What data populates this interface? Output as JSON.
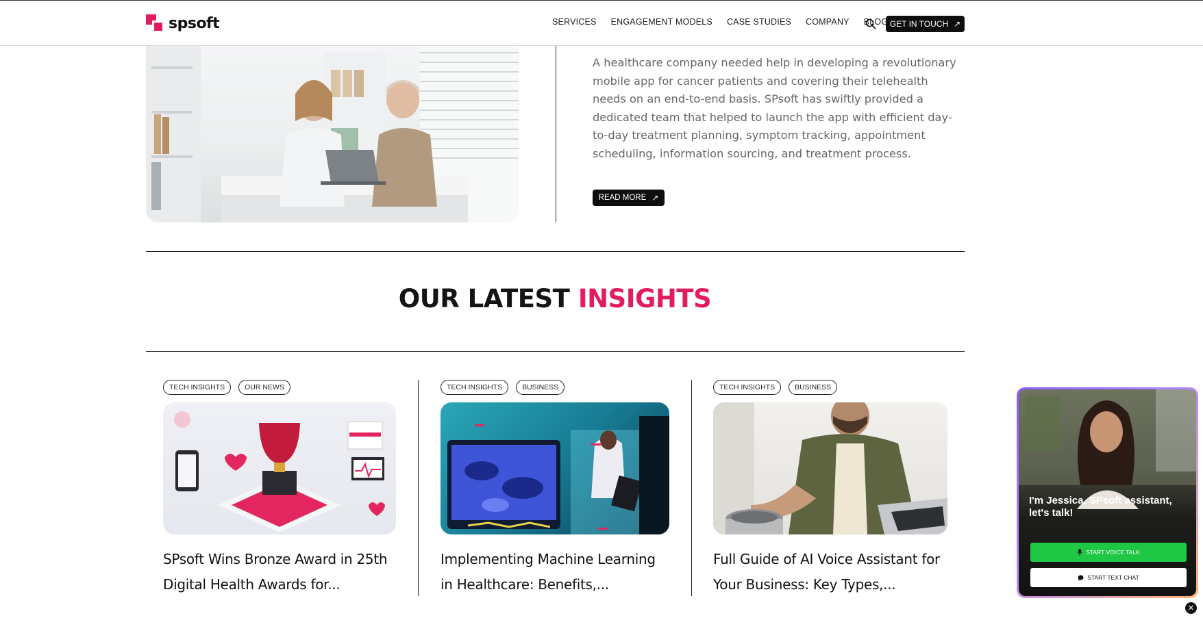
{
  "header": {
    "logo_text": "spsoft",
    "nav": [
      "SERVICES",
      "ENGAGEMENT MODELS",
      "CASE STUDIES",
      "COMPANY",
      "BLOG"
    ],
    "cta_label": "GET IN TOUCH",
    "icons": {
      "search": "search-icon",
      "cta_arrow": "arrow-up-right-icon"
    }
  },
  "case_study": {
    "description": "A healthcare company needed help in developing a revolutionary mobile app for cancer patients and covering their telehealth needs on an end-to-end basis. SPsoft has swiftly provided a dedicated team that helped to launch the app with efficient day-to-day treatment planning, symptom tracking, appointment scheduling, information sourcing, and treatment process.",
    "read_more_label": "READ MORE"
  },
  "insights": {
    "title_part1": "OUR LATEST",
    "title_part2": "INSIGHTS",
    "cards": [
      {
        "tags": [
          "TECH INSIGHTS",
          "OUR NEWS"
        ],
        "title": "SPsoft Wins Bronze Award in 25th Digital Health Awards for..."
      },
      {
        "tags": [
          "TECH INSIGHTS",
          "BUSINESS"
        ],
        "title": "Implementing Machine Learning in Healthcare: Benefits,..."
      },
      {
        "tags": [
          "TECH INSIGHTS",
          "BUSINESS"
        ],
        "title": "Full Guide of AI Voice Assistant for Your Business: Key Types,..."
      }
    ]
  },
  "chat_widget": {
    "greeting": "I'm Jessica, SPsoft assistant, let's talk!",
    "voice_label": "START VOICE TALK",
    "text_label": "START TEXT CHAT",
    "close_icon": "close-icon"
  },
  "colors": {
    "accent": "#e31c5f",
    "button_dark": "#0e0e0e",
    "voice_green": "#1ec845"
  }
}
